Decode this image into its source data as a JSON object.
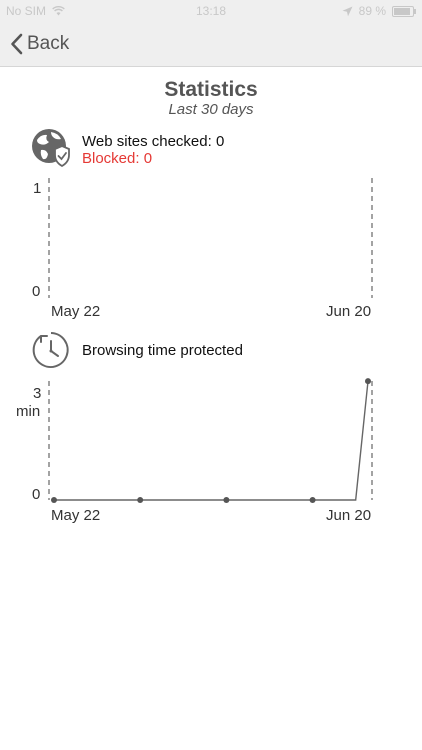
{
  "status_bar": {
    "carrier": "No SIM",
    "time": "13:18",
    "battery": "89 %",
    "icons": [
      "wifi-icon",
      "location-arrow-icon",
      "battery-icon"
    ]
  },
  "nav": {
    "back_label": "Back",
    "back_icon": "chevron-left-icon"
  },
  "header": {
    "title": "Statistics",
    "subtitle": "Last 30 days"
  },
  "websites": {
    "icon": "globe-shield-icon",
    "checked_label": "Web sites checked: 0",
    "blocked_label": "Blocked: 0",
    "blocked_color": "#e53935"
  },
  "browsing": {
    "icon": "clock-icon",
    "label": "Browsing time protected"
  },
  "chart_data": [
    {
      "type": "line",
      "title": "",
      "x_start_label": "May 22",
      "x_end_label": "Jun 20",
      "ylim": [
        0,
        1
      ],
      "y_ticks": [
        "1",
        "0"
      ],
      "y_unit": "",
      "series": []
    },
    {
      "type": "line",
      "title": "",
      "x_start_label": "May 22",
      "x_end_label": "Jun 20",
      "ylim": [
        0,
        3
      ],
      "y_ticks": [
        "3",
        "0"
      ],
      "y_unit": "min",
      "series": [
        {
          "points": [
            {
              "day": 0,
              "value": 0
            },
            {
              "day": 7,
              "value": 0
            },
            {
              "day": 14,
              "value": 0
            },
            {
              "day": 21,
              "value": 0
            },
            {
              "day": 24.5,
              "value": 0
            },
            {
              "day": 25.5,
              "value": 3.1
            }
          ],
          "markers": [
            0,
            7,
            14,
            21,
            25.5
          ]
        }
      ]
    }
  ]
}
